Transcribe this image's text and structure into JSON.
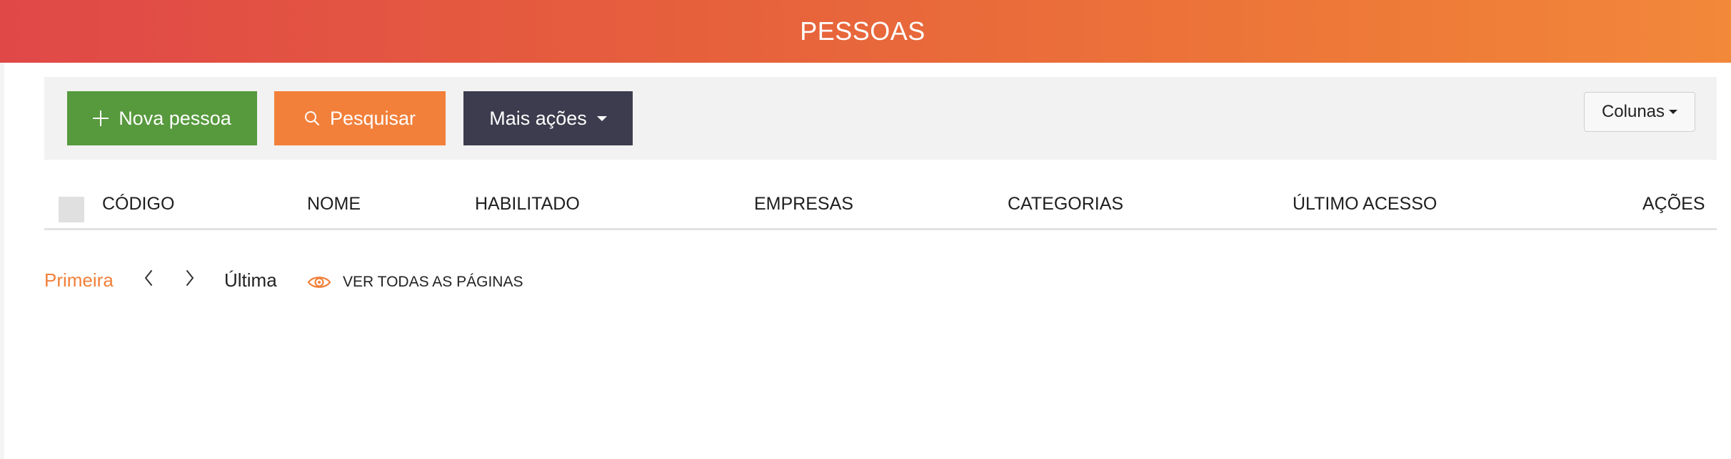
{
  "header": {
    "title": "PESSOAS"
  },
  "toolbar": {
    "new_label": "Nova pessoa",
    "search_label": "Pesquisar",
    "more_label": "Mais ações",
    "columns_label": "Colunas"
  },
  "table": {
    "columns": [
      "CÓDIGO",
      "NOME",
      "HABILITADO",
      "EMPRESAS",
      "CATEGORIAS",
      "ÚLTIMO ACESSO",
      "AÇÕES"
    ]
  },
  "pagination": {
    "first": "Primeira",
    "last": "Última",
    "view_all": "VER TODAS AS PÁGINAS"
  },
  "icons": {
    "new": "plus-icon",
    "search": "search-icon",
    "more": "caret-down-icon",
    "prev": "chevron-left-icon",
    "next": "chevron-right-icon",
    "view_all": "eye-icon"
  },
  "colors": {
    "header_start": "#e04848",
    "header_end": "#f2883a",
    "new_button": "#57993d",
    "search_button": "#f2803a",
    "more_button": "#3c3c4e",
    "accent": "#f2803a"
  }
}
